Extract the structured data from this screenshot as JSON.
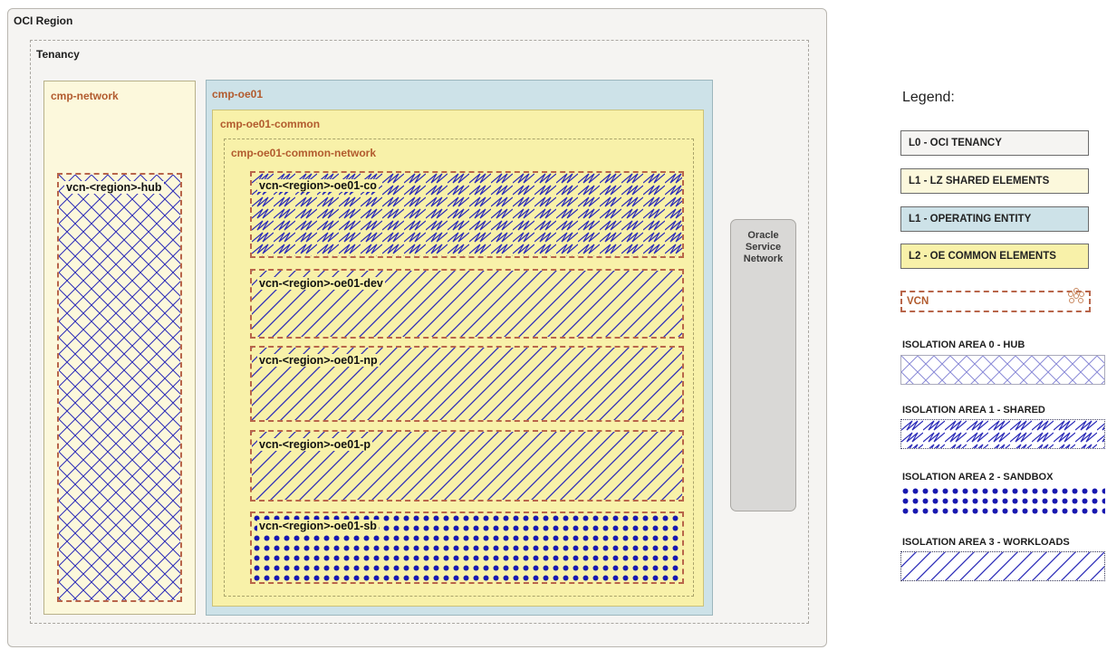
{
  "diagram": {
    "region": {
      "label": "OCI Region"
    },
    "tenancy": {
      "label": "Tenancy"
    },
    "cmp_network": {
      "label": "cmp-network"
    },
    "cmp_oe01": {
      "label": "cmp-oe01"
    },
    "cmp_oe01_common": {
      "label": "cmp-oe01-common"
    },
    "cmp_oe01_common_network": {
      "label": "cmp-oe01-common-network"
    },
    "vcns": {
      "hub": "vcn-<region>-hub",
      "co": "vcn-<region>-oe01-co",
      "dev": "vcn-<region>-oe01-dev",
      "np": "vcn-<region>-oe01-np",
      "p": "vcn-<region>-oe01-p",
      "sb": "vcn-<region>-oe01-sb"
    },
    "oracle_service_network": {
      "label": "Oracle\nService\nNetwork"
    }
  },
  "legend": {
    "title": "Legend:",
    "boxes": [
      {
        "label": "L0 - OCI TENANCY",
        "color": "#f5f4f2"
      },
      {
        "label": "L1 - LZ SHARED ELEMENTS",
        "color": "#fcf8dc"
      },
      {
        "label": "L1 - OPERATING ENTITY",
        "color": "#cde2e8"
      },
      {
        "label": "L2 - OE COMMON ELEMENTS",
        "color": "#f8f1a9"
      }
    ],
    "vcn": {
      "label": "VCN",
      "icon": "vcn-network-icon"
    },
    "isolation": [
      {
        "label": "ISOLATION AREA 0 - HUB",
        "pattern": "crosshatch"
      },
      {
        "label": "ISOLATION AREA 1 - SHARED",
        "pattern": "zigzag"
      },
      {
        "label": "ISOLATION AREA 2 - SANDBOX",
        "pattern": "dots"
      },
      {
        "label": "ISOLATION AREA 3 - WORKLOADS",
        "pattern": "diagonal"
      }
    ]
  },
  "colors": {
    "pattern_blue": "#2b2bb8",
    "vcn_border": "#b8654a",
    "label_brown": "#b25b2e"
  }
}
